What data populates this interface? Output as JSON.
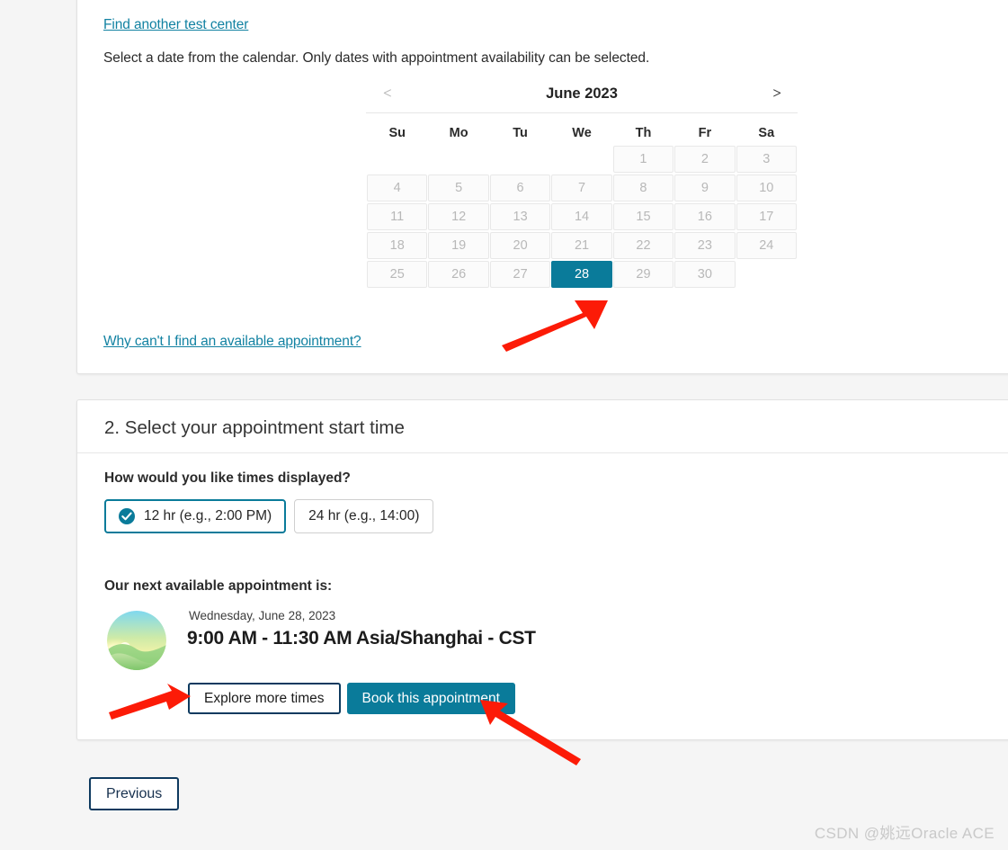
{
  "links": {
    "find_center": "Find another test center",
    "why_no_appointment": "Why can't I find an available appointment?"
  },
  "instructions": "Select a date from the calendar. Only dates with appointment availability can be selected.",
  "calendar": {
    "title": "June 2023",
    "prev_label": "<",
    "next_label": ">",
    "weekdays": [
      "Su",
      "Mo",
      "Tu",
      "We",
      "Th",
      "Fr",
      "Sa"
    ],
    "leading_blanks": 4,
    "days": [
      {
        "n": "1",
        "state": "disabled"
      },
      {
        "n": "2",
        "state": "disabled"
      },
      {
        "n": "3",
        "state": "disabled"
      },
      {
        "n": "4",
        "state": "disabled"
      },
      {
        "n": "5",
        "state": "disabled"
      },
      {
        "n": "6",
        "state": "disabled"
      },
      {
        "n": "7",
        "state": "disabled"
      },
      {
        "n": "8",
        "state": "disabled"
      },
      {
        "n": "9",
        "state": "disabled"
      },
      {
        "n": "10",
        "state": "disabled"
      },
      {
        "n": "11",
        "state": "disabled"
      },
      {
        "n": "12",
        "state": "disabled"
      },
      {
        "n": "13",
        "state": "disabled"
      },
      {
        "n": "14",
        "state": "disabled"
      },
      {
        "n": "15",
        "state": "disabled"
      },
      {
        "n": "16",
        "state": "disabled"
      },
      {
        "n": "17",
        "state": "disabled"
      },
      {
        "n": "18",
        "state": "disabled"
      },
      {
        "n": "19",
        "state": "disabled"
      },
      {
        "n": "20",
        "state": "disabled"
      },
      {
        "n": "21",
        "state": "disabled"
      },
      {
        "n": "22",
        "state": "disabled"
      },
      {
        "n": "23",
        "state": "disabled"
      },
      {
        "n": "24",
        "state": "disabled"
      },
      {
        "n": "25",
        "state": "disabled"
      },
      {
        "n": "26",
        "state": "disabled"
      },
      {
        "n": "27",
        "state": "disabled"
      },
      {
        "n": "28",
        "state": "selected"
      },
      {
        "n": "29",
        "state": "disabled"
      },
      {
        "n": "30",
        "state": "disabled"
      }
    ],
    "selected_day": "28"
  },
  "section_two": {
    "title": "2. Select your appointment start time",
    "question": "How would you like times displayed?",
    "format_options": [
      {
        "label": "12 hr (e.g., 2:00 PM)",
        "selected": true
      },
      {
        "label": "24 hr (e.g., 14:00)",
        "selected": false
      }
    ],
    "next_available_label": "Our next available appointment is:",
    "appointment": {
      "date": "Wednesday, June 28, 2023",
      "time": "9:00 AM - 11:30 AM Asia/Shanghai - CST",
      "icon": "sunrise-icon"
    },
    "explore_button": "Explore more times",
    "book_button": "Book this appointment"
  },
  "footer": {
    "previous_button": "Previous"
  },
  "watermark": "CSDN @姚远Oracle ACE",
  "colors": {
    "accent_teal": "#0a7b9a",
    "link_blue": "#1282a2",
    "navy_border": "#0e3a5f",
    "page_bg": "#f5f5f5",
    "arrow_red": "#fc1b07"
  }
}
